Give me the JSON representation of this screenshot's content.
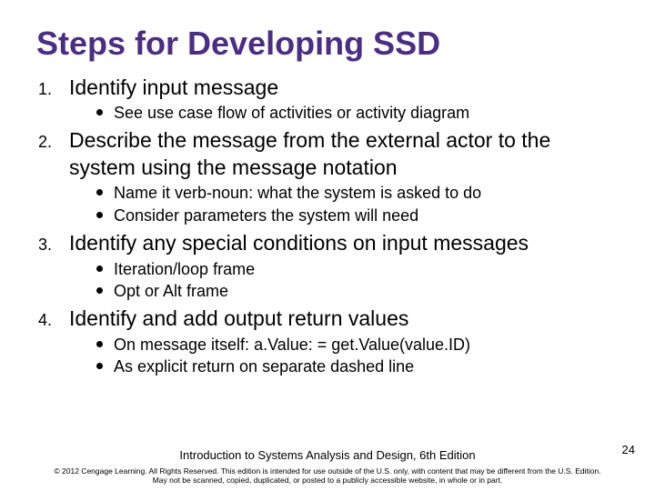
{
  "title": "Steps for Developing SSD",
  "steps": [
    {
      "num": "1.",
      "text": "Identify input message",
      "subs": [
        "See use case flow of activities or activity diagram"
      ]
    },
    {
      "num": "2.",
      "text": "Describe the message from the external actor to the system using the message notation",
      "subs": [
        "Name it verb-noun: what the system is asked to do",
        "Consider parameters the system will need"
      ]
    },
    {
      "num": "3.",
      "text": "Identify any special conditions on input messages",
      "subs": [
        "Iteration/loop frame",
        "Opt or Alt frame"
      ]
    },
    {
      "num": "4.",
      "text": "Identify and add output return values",
      "subs": [
        "On message itself: a.Value: = get.Value(value.ID)",
        "As explicit return on separate dashed line"
      ]
    }
  ],
  "footer": "Introduction to Systems Analysis and Design, 6th Edition",
  "page_number": "24",
  "copyright_line1": "© 2012 Cengage Learning. All Rights Reserved. This edition is intended for use outside of the U.S. only, with content that may be different from the U.S. Edition.",
  "copyright_line2": "May not be scanned, copied, duplicated, or posted to a publicly accessible website, in whole or in part."
}
